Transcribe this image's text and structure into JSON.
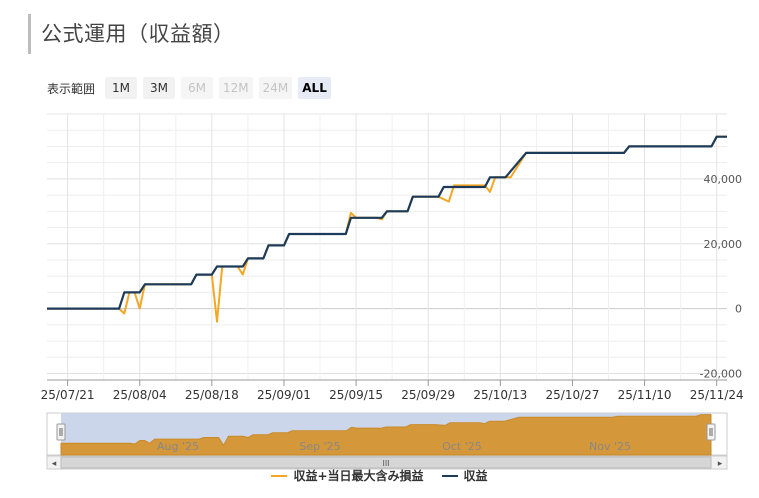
{
  "header": {
    "title": "公式運用（収益額）"
  },
  "range_selector": {
    "label": "表示範囲",
    "buttons": [
      {
        "label": "1M",
        "state": "enabled"
      },
      {
        "label": "3M",
        "state": "enabled"
      },
      {
        "label": "6M",
        "state": "disabled"
      },
      {
        "label": "12M",
        "state": "disabled"
      },
      {
        "label": "24M",
        "state": "disabled"
      },
      {
        "label": "ALL",
        "state": "active"
      }
    ]
  },
  "navigator": {
    "labels": [
      "Aug '25",
      "Sep '25",
      "Oct '25",
      "Nov '25"
    ],
    "grip": "III",
    "left_arrow": "◂",
    "right_arrow": "▸"
  },
  "colors": {
    "orange": "#f5a623",
    "navy": "#1c3a5a",
    "navigator_fill": "#d4973a",
    "navigator_mask": "#ccd6eb"
  },
  "chart_data": {
    "type": "line",
    "x_unit": "date",
    "ylim": [
      -22000,
      60000
    ],
    "yticks": [
      -20000,
      0,
      20000,
      40000
    ],
    "ytick_labels": [
      "-20,000",
      "0",
      "20,000",
      "40,000"
    ],
    "xticks": [
      "2025-07-21",
      "2025-08-04",
      "2025-08-18",
      "2025-09-01",
      "2025-09-15",
      "2025-09-29",
      "2025-10-13",
      "2025-10-27",
      "2025-11-10",
      "2025-11-24"
    ],
    "xtick_labels": [
      "25/07/21",
      "25/08/04",
      "25/08/18",
      "25/09/01",
      "25/09/15",
      "25/09/29",
      "25/10/13",
      "25/10/27",
      "25/11/10",
      "25/11/24"
    ],
    "x_range": [
      "2025-07-17",
      "2025-11-26"
    ],
    "series": [
      {
        "name": "収益+当日最大含み損益",
        "color": "#f5a623",
        "points": [
          [
            "2025-07-17",
            0
          ],
          [
            "2025-07-31",
            0
          ],
          [
            "2025-08-01",
            -1500
          ],
          [
            "2025-08-02",
            5000
          ],
          [
            "2025-08-03",
            5000
          ],
          [
            "2025-08-04",
            0
          ],
          [
            "2025-08-05",
            7500
          ],
          [
            "2025-08-14",
            7500
          ],
          [
            "2025-08-15",
            10500
          ],
          [
            "2025-08-18",
            10500
          ],
          [
            "2025-08-19",
            -4000
          ],
          [
            "2025-08-20",
            13000
          ],
          [
            "2025-08-23",
            13000
          ],
          [
            "2025-08-24",
            10500
          ],
          [
            "2025-08-25",
            15500
          ],
          [
            "2025-08-28",
            15500
          ],
          [
            "2025-08-29",
            19500
          ],
          [
            "2025-09-01",
            19500
          ],
          [
            "2025-09-02",
            23000
          ],
          [
            "2025-09-13",
            23000
          ],
          [
            "2025-09-14",
            29500
          ],
          [
            "2025-09-15",
            28000
          ],
          [
            "2025-09-19",
            28000
          ],
          [
            "2025-09-20",
            27500
          ],
          [
            "2025-09-21",
            30000
          ],
          [
            "2025-09-25",
            30000
          ],
          [
            "2025-09-26",
            34500
          ],
          [
            "2025-10-01",
            34500
          ],
          [
            "2025-10-03",
            33000
          ],
          [
            "2025-10-04",
            38000
          ],
          [
            "2025-10-10",
            38000
          ],
          [
            "2025-10-11",
            36000
          ],
          [
            "2025-10-12",
            40500
          ],
          [
            "2025-10-15",
            40500
          ],
          [
            "2025-10-18",
            48000
          ],
          [
            "2025-11-06",
            48000
          ],
          [
            "2025-11-07",
            50000
          ],
          [
            "2025-11-23",
            50000
          ],
          [
            "2025-11-24",
            53000
          ],
          [
            "2025-11-26",
            53000
          ]
        ]
      },
      {
        "name": "収益",
        "color": "#1c3a5a",
        "points": [
          [
            "2025-07-17",
            0
          ],
          [
            "2025-07-31",
            0
          ],
          [
            "2025-08-01",
            5000
          ],
          [
            "2025-08-04",
            5000
          ],
          [
            "2025-08-05",
            7500
          ],
          [
            "2025-08-14",
            7500
          ],
          [
            "2025-08-15",
            10500
          ],
          [
            "2025-08-18",
            10500
          ],
          [
            "2025-08-19",
            13000
          ],
          [
            "2025-08-24",
            13000
          ],
          [
            "2025-08-25",
            15500
          ],
          [
            "2025-08-28",
            15500
          ],
          [
            "2025-08-29",
            19500
          ],
          [
            "2025-09-01",
            19500
          ],
          [
            "2025-09-02",
            23000
          ],
          [
            "2025-09-13",
            23000
          ],
          [
            "2025-09-14",
            28000
          ],
          [
            "2025-09-20",
            28000
          ],
          [
            "2025-09-21",
            30000
          ],
          [
            "2025-09-25",
            30000
          ],
          [
            "2025-09-26",
            34500
          ],
          [
            "2025-10-01",
            34500
          ],
          [
            "2025-10-02",
            37500
          ],
          [
            "2025-10-10",
            37500
          ],
          [
            "2025-10-11",
            40500
          ],
          [
            "2025-10-14",
            40500
          ],
          [
            "2025-10-18",
            48000
          ],
          [
            "2025-11-06",
            48000
          ],
          [
            "2025-11-07",
            50000
          ],
          [
            "2025-11-23",
            50000
          ],
          [
            "2025-11-24",
            53000
          ],
          [
            "2025-11-26",
            53000
          ]
        ]
      }
    ]
  }
}
